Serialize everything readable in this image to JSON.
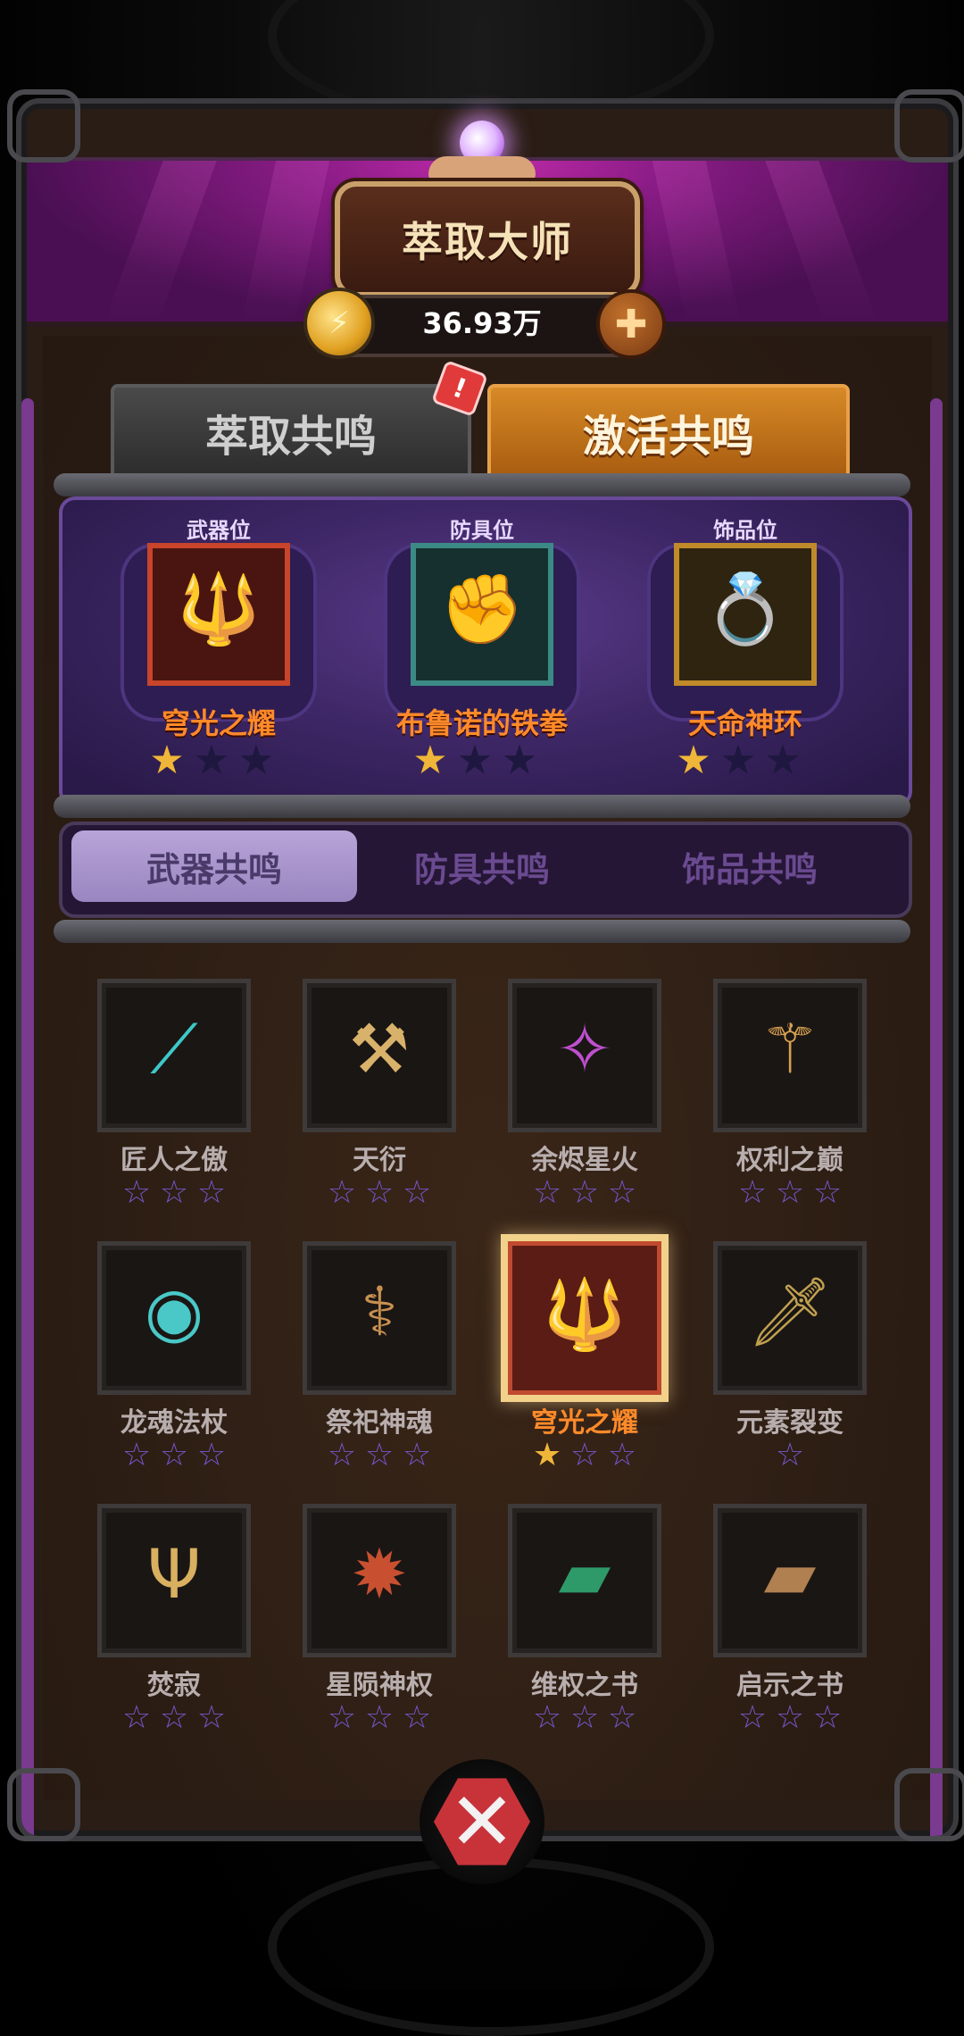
{
  "header": {
    "title": "萃取大师",
    "currency_value": "36.93万"
  },
  "tabs": [
    {
      "label": "萃取共鸣",
      "active": false
    },
    {
      "label": "激活共鸣",
      "active": true
    }
  ],
  "equipped_slots": [
    {
      "slot_label": "武器位",
      "item_name": "穹光之耀",
      "stars_filled": 1,
      "stars_total": 3,
      "frame_color": "#c8442a",
      "icon": "trident-icon"
    },
    {
      "slot_label": "防具位",
      "item_name": "布鲁诺的铁拳",
      "stars_filled": 1,
      "stars_total": 3,
      "frame_color": "#3c8a86",
      "icon": "gauntlet-icon"
    },
    {
      "slot_label": "饰品位",
      "item_name": "天命神环",
      "stars_filled": 1,
      "stars_total": 3,
      "frame_color": "#c08a2a",
      "icon": "ring-icon"
    }
  ],
  "subtabs": [
    {
      "label": "武器共鸣",
      "active": true
    },
    {
      "label": "防具共鸣",
      "active": false
    },
    {
      "label": "饰品共鸣",
      "active": false
    }
  ],
  "weapons": [
    {
      "name": "匠人之傲",
      "stars_total": 3,
      "stars_filled": 0,
      "icon": "claw-icon"
    },
    {
      "name": "天衍",
      "stars_total": 3,
      "stars_filled": 0,
      "icon": "hammer-icon"
    },
    {
      "name": "余烬星火",
      "stars_total": 3,
      "stars_filled": 0,
      "icon": "staff-icon"
    },
    {
      "name": "权利之巅",
      "stars_total": 3,
      "stars_filled": 0,
      "icon": "scepter-icon"
    },
    {
      "name": "龙魂法杖",
      "stars_total": 3,
      "stars_filled": 0,
      "icon": "dragon-staff-icon"
    },
    {
      "name": "祭祀神魂",
      "stars_total": 3,
      "stars_filled": 0,
      "icon": "ritual-staff-icon"
    },
    {
      "name": "穹光之耀",
      "stars_total": 3,
      "stars_filled": 1,
      "icon": "trident-icon",
      "selected": true
    },
    {
      "name": "元素裂变",
      "stars_total": 1,
      "stars_filled": 0,
      "icon": "dagger-icon"
    },
    {
      "name": "焚寂",
      "stars_total": 3,
      "stars_filled": 0,
      "icon": "fork-icon"
    },
    {
      "name": "星陨神权",
      "stars_total": 3,
      "stars_filled": 0,
      "icon": "mace-icon"
    },
    {
      "name": "维权之书",
      "stars_total": 3,
      "stars_filled": 0,
      "icon": "green-book-icon"
    },
    {
      "name": "启示之书",
      "stars_total": 3,
      "stars_filled": 0,
      "icon": "brown-book-icon"
    }
  ],
  "colors": {
    "accent_orange": "#ff8a2a",
    "star_gold": "#f0b63a",
    "star_outline": "#7a5acb",
    "banner_purple": "#8a1c86",
    "tab_active": "#d78a26",
    "close_red": "#c8333a"
  }
}
